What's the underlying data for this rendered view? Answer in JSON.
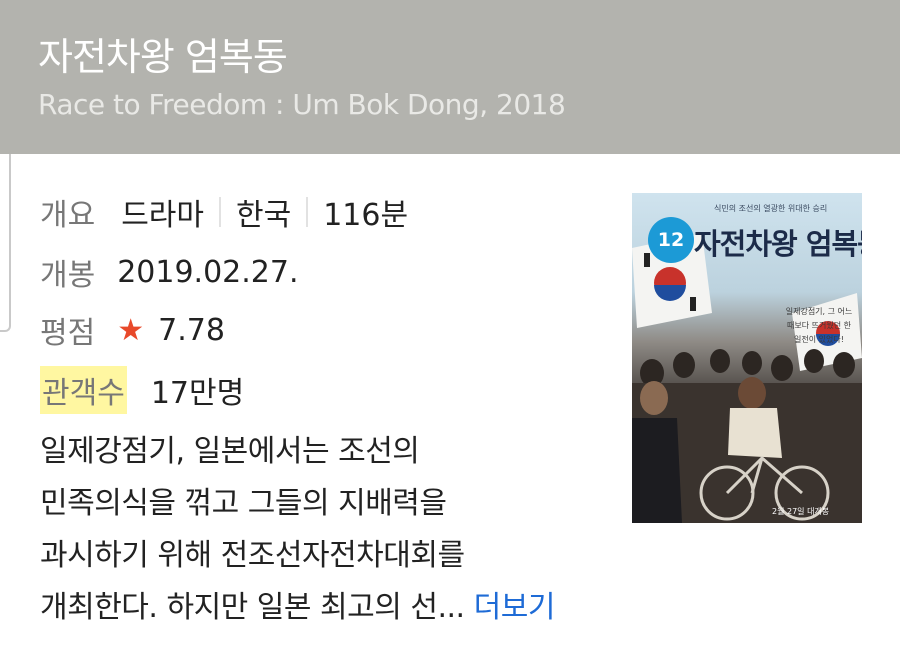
{
  "header": {
    "title": "자전차왕 엄복동",
    "subtitle": "Race to Freedom : Um Bok Dong, 2018"
  },
  "info": {
    "overview_label": "개요",
    "genre": "드라마",
    "country": "한국",
    "runtime": "116분",
    "release_label": "개봉",
    "release_date": "2019.02.27.",
    "rating_label": "평점",
    "rating_star": "★",
    "rating_value": "7.78",
    "audience_label": "관객수",
    "audience_value": "17만명"
  },
  "description": {
    "line1": "일제강점기, 일본에서는 조선의",
    "line2": "민족의식을 꺾고 그들의 지배력을",
    "line3": "과시하기 위해 전조선자전차대회를",
    "line4": "개최한다. 하지만 일본 최고의 선...",
    "more_label": "더보기"
  },
  "poster": {
    "age_rating": "12",
    "title": "자전차왕 엄복동",
    "tagline": "식민의 조선의 열광한 위대한 승리",
    "copy": "일제강점기, 그 어느 때보다 뜨거웠던 한일전이 있었다!",
    "release_text": "2월 27일 대개봉"
  },
  "colors": {
    "header_bg": "#b3b3ae",
    "star": "#e8492a",
    "link": "#1e6bd6",
    "highlight": "#fff7a1",
    "badge": "#1c9ad6"
  }
}
